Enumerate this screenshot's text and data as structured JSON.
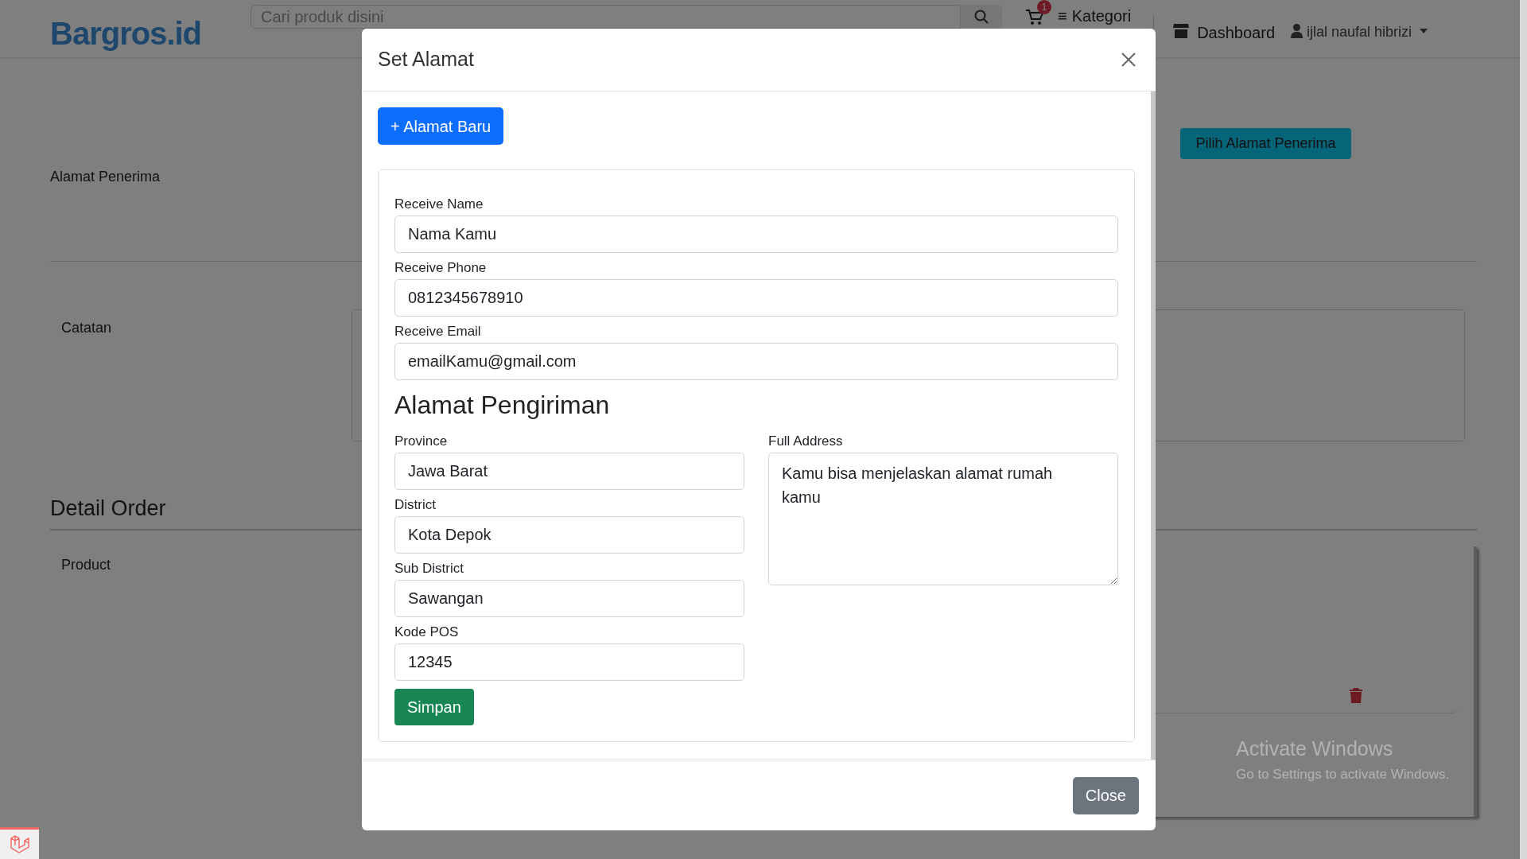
{
  "navbar": {
    "logo": "Bargros.id",
    "search": {
      "placeholder": "Cari produk disini"
    },
    "cart_count": "1",
    "menu_icon": "≡",
    "menu_label": "Kategori",
    "dashboard": "Dashboard",
    "user_name": "ijlal naufal hibrizi"
  },
  "page": {
    "address_label": "Alamat Penerima",
    "choose_button": "Pilih Alamat Penerima",
    "notes_label": "Catatan",
    "detail_title": "Detail Order",
    "product_label": "Product"
  },
  "modal": {
    "title": "Set Alamat",
    "new_button": "+ Alamat Baru",
    "contact_fields": [
      {
        "label": "Receive Name",
        "value": "Nama Kamu"
      },
      {
        "label": "Receive Phone",
        "value": "0812345678910"
      },
      {
        "label": "Receive Email",
        "value": "emailKamu@gmail.com"
      }
    ],
    "section_title": "Alamat Pengiriman",
    "address_fields": [
      {
        "label": "Province",
        "value": "Jawa Barat"
      },
      {
        "label": "District",
        "value": "Kota Depok"
      },
      {
        "label": "Sub District",
        "value": "Sawangan"
      },
      {
        "label": "Kode POS",
        "value": "12345"
      }
    ],
    "full_address": {
      "label": "Full Address",
      "value": "Kamu bisa menjelaskan alamat rumah kamu"
    },
    "save_button": "Simpan",
    "close_button": "Close"
  },
  "os_notice": {
    "title": "Activate Windows",
    "text": "Go to Settings to activate Windows."
  }
}
